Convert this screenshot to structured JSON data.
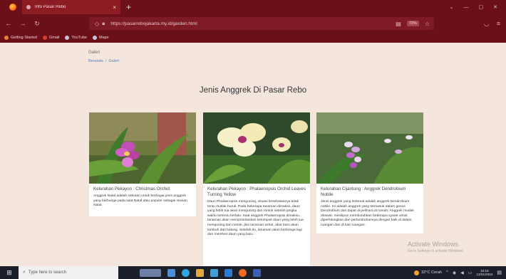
{
  "browser": {
    "tab_title": "Info Pasar Rebo",
    "tab_close": "×",
    "new_tab": "+",
    "url": "https://pasarrebojakarta.my.id/garden.html",
    "zoom": "70%",
    "bookmarks": [
      {
        "label": "Getting Started",
        "icon": "firefox-icon"
      },
      {
        "label": "Gmail",
        "icon": "gmail-icon"
      },
      {
        "label": "YouTube",
        "icon": "globe-icon"
      },
      {
        "label": "Maps",
        "icon": "globe-icon"
      }
    ]
  },
  "page": {
    "crumb_title": "Galeri",
    "breadcrumb": [
      {
        "label": "Beranda"
      },
      {
        "label": "Galeri"
      }
    ],
    "breadcrumb_sep": "/",
    "heading": "Jenis Anggrek Di Pasar Rebo",
    "cards": [
      {
        "title": "Kelurahan Pekayon : Christmas Orchid",
        "text": "Anggrek Natal adalah sebutan untuk berbagai jenis anggrek yang berbunga pada saat Natal atau populer sebagai Hiasan Natal."
      },
      {
        "title": "Kelurahan Pekayon : Phalaenopsis Orchid Leaves Turning Yellow",
        "text": "Daun Phalaenopsis menguning, situasi kesehatannya tidak tentu mutlak buruk. Pada beberapa tanaman dimaksu, daun yang lebih tua akan menguning dan rontok setelah jangka waktu tertentu berlalu. Saat anggrek Phalaenopsis dimaksu, tanaman akan memprioritaskan kelompok daun yang lebih tua menguning dan rontok, jika tanaman sehat, akar baru akan tumbuh dari batang. Setelah itu, tanaman akan berbunga lagi dan memberi daun yang baru."
      },
      {
        "title": "Kelurahan Cijantung : Anggrek Dendrobium Nobile",
        "text": "Jenis anggrek yang terkenal adalah anggrek Dendrobium nobile. Ini adalah anggrek yang termasuk dalam genus Dendrobium dan dapat di pelihara di rumah. Anggrek mudah dirawat, meskipun membutuhkan beberapa syarat untuk diperhitungkan dan pertumbuhannya dengan baik di dalam ruangan dan di luar ruangan."
      }
    ]
  },
  "watermark": {
    "line1": "Activate Windows",
    "line2": "Go to Settings to activate Windows."
  },
  "taskbar": {
    "search_placeholder": "Type here to search",
    "weather": "32°C Cerah",
    "time": "15:16",
    "date": "13/01/2024"
  }
}
